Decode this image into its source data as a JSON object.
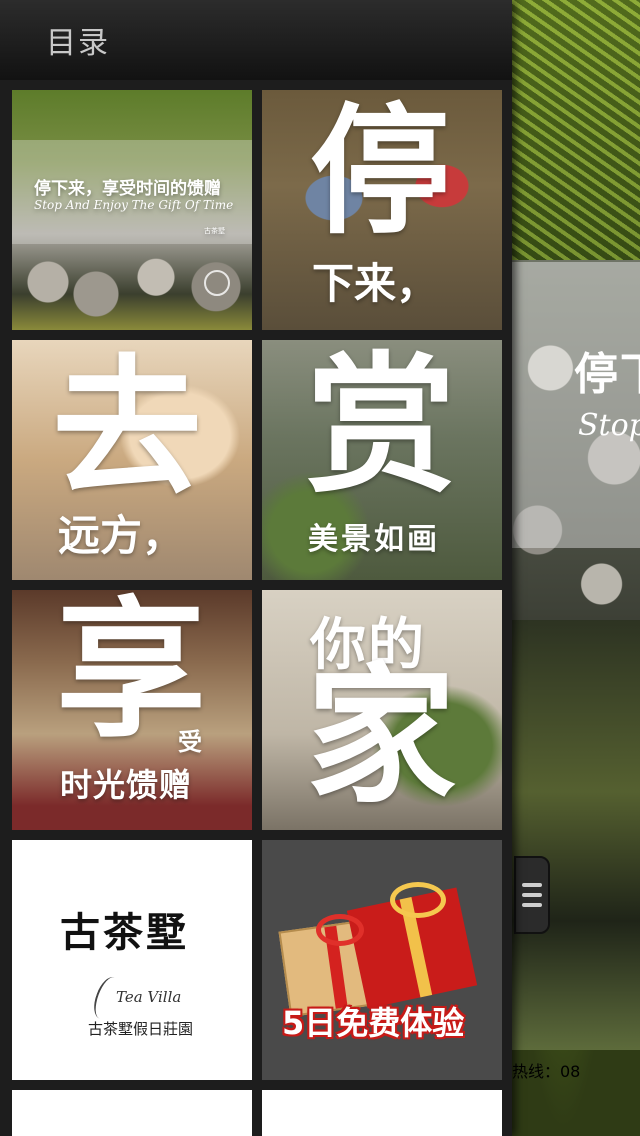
{
  "drawer": {
    "title": "目录"
  },
  "tiles": [
    {
      "id": "stop-and-enjoy",
      "headline": "停下来，享受时间的馈赠",
      "subtitle": "Stop And Enjoy The Gift Of Time",
      "logo_text": "古茶墅"
    },
    {
      "id": "stop",
      "big": "停",
      "sub": "下来，"
    },
    {
      "id": "go",
      "big": "去",
      "sub": "远方，"
    },
    {
      "id": "view",
      "big": "赏",
      "sub": "美景如画"
    },
    {
      "id": "enjoy",
      "big": "享",
      "small": "受",
      "sub": "时光馈赠"
    },
    {
      "id": "home",
      "sub": "你的",
      "big": "家"
    },
    {
      "id": "brand",
      "name": "古茶墅",
      "script": "Tea Villa",
      "cn": "古茶墅假日莊園"
    },
    {
      "id": "trial",
      "label": "5日免费体验"
    }
  ],
  "background_page": {
    "headline_fragment": "停下",
    "script_fragment": "Stop",
    "hotline": "热线：08"
  },
  "icons": {
    "menu_handle": "hamburger-icon",
    "touch": "tap-hand-icon",
    "gift": "gift-icon",
    "leaf": "tea-leaf-logo-icon"
  },
  "colors": {
    "drawer_bg": "#1d1d1d",
    "header_text": "#c8c8c8",
    "trial_red": "#c71b18"
  }
}
